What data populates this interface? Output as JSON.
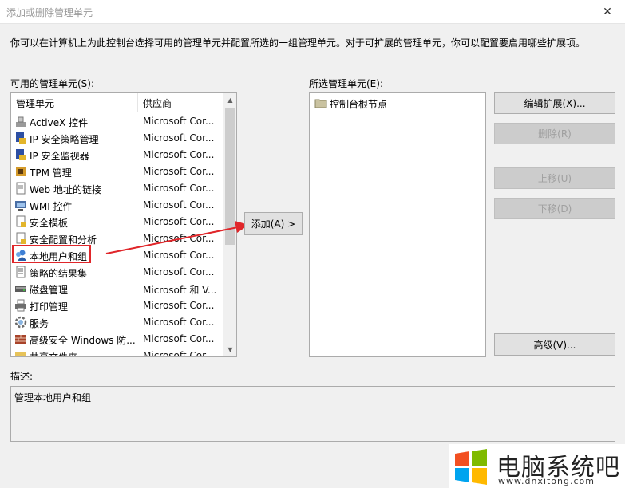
{
  "window": {
    "title": "添加或删除管理单元",
    "close_glyph": "✕"
  },
  "intro_text": "你可以在计算机上为此控制台选择可用的管理单元并配置所选的一组管理单元。对于可扩展的管理单元，你可以配置要启用哪些扩展项。",
  "available": {
    "label": "可用的管理单元(S):",
    "columns": {
      "name": "管理单元",
      "vendor": "供应商"
    },
    "items": [
      {
        "name": "ActiveX 控件",
        "vendor": "Microsoft Cor...",
        "icon": "activex-icon"
      },
      {
        "name": "IP 安全策略管理",
        "vendor": "Microsoft Cor...",
        "icon": "ip-security-policy-icon"
      },
      {
        "name": "IP 安全监视器",
        "vendor": "Microsoft Cor...",
        "icon": "ip-security-monitor-icon"
      },
      {
        "name": "TPM 管理",
        "vendor": "Microsoft Cor...",
        "icon": "tpm-icon"
      },
      {
        "name": "Web 地址的链接",
        "vendor": "Microsoft Cor...",
        "icon": "web-link-icon"
      },
      {
        "name": "WMI 控件",
        "vendor": "Microsoft Cor...",
        "icon": "wmi-icon"
      },
      {
        "name": "安全模板",
        "vendor": "Microsoft Cor...",
        "icon": "security-template-icon"
      },
      {
        "name": "安全配置和分析",
        "vendor": "Microsoft Cor...",
        "icon": "security-config-icon"
      },
      {
        "name": "本地用户和组",
        "vendor": "Microsoft Cor...",
        "icon": "local-users-icon"
      },
      {
        "name": "策略的结果集",
        "vendor": "Microsoft Cor...",
        "icon": "policy-result-icon"
      },
      {
        "name": "磁盘管理",
        "vendor": "Microsoft 和 V...",
        "icon": "disk-management-icon"
      },
      {
        "name": "打印管理",
        "vendor": "Microsoft Cor...",
        "icon": "print-management-icon"
      },
      {
        "name": "服务",
        "vendor": "Microsoft Cor...",
        "icon": "services-gear-icon"
      },
      {
        "name": "高级安全 Windows 防...",
        "vendor": "Microsoft Cor...",
        "icon": "firewall-icon"
      },
      {
        "name": "共享文件夹",
        "vendor": "Microsoft Cor...",
        "icon": "shared-folder-icon"
      }
    ]
  },
  "buttons": {
    "add": "添加(A) >",
    "edit_extensions": "编辑扩展(X)...",
    "remove": "删除(R)",
    "move_up": "上移(U)",
    "move_down": "下移(D)",
    "advanced": "高级(V)..."
  },
  "selected": {
    "label": "所选管理单元(E):",
    "items": [
      {
        "name": "控制台根节点",
        "icon": "folder-icon"
      }
    ]
  },
  "description": {
    "label": "描述:",
    "text": "管理本地用户和组"
  },
  "watermark": {
    "title": "电脑系统吧",
    "url": "www.dnxitong.com"
  },
  "colors": {
    "highlight": "#e0262a",
    "window_bg": "#f0f0f0",
    "disabled_text": "#a0a0a0"
  }
}
